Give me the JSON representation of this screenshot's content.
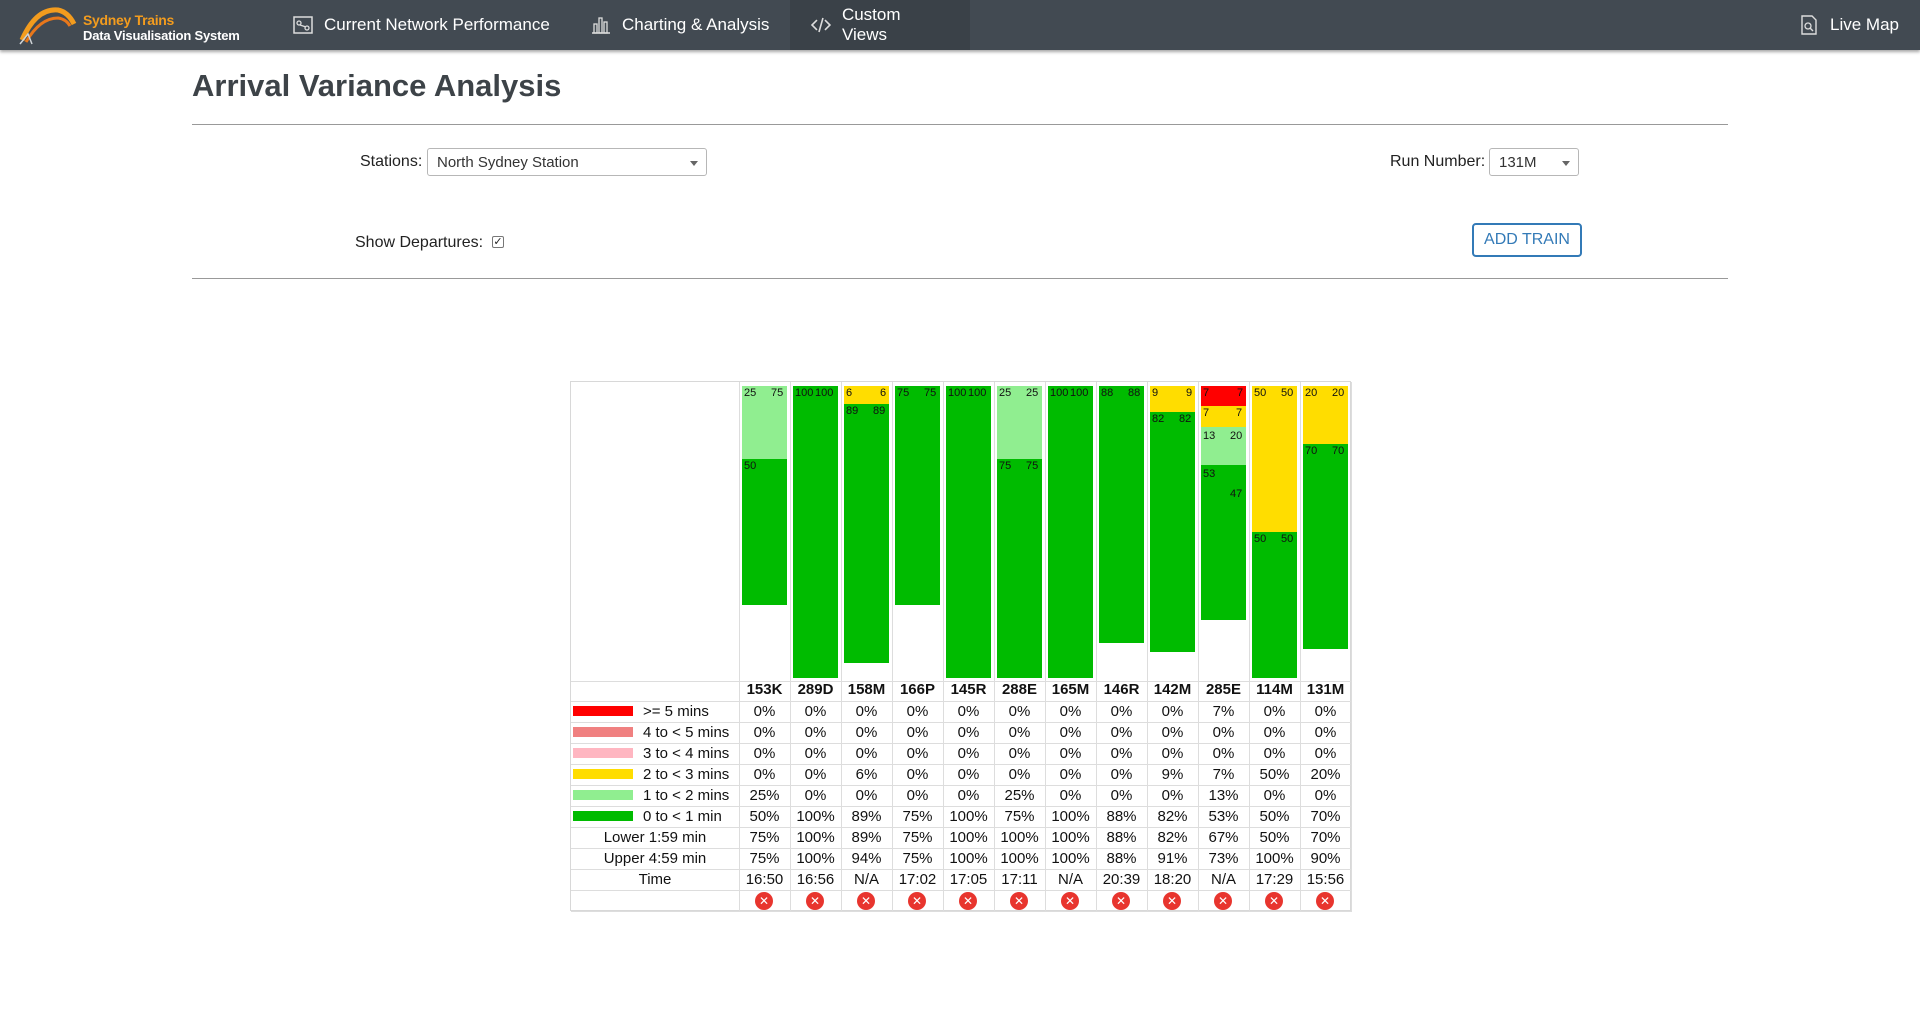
{
  "nav": {
    "brand_line1": "Sydney Trains",
    "brand_line2": "Data Visualisation System",
    "items": [
      {
        "label": "Current Network Performance",
        "icon": "network-icon"
      },
      {
        "label": "Charting & Analysis",
        "icon": "bar-chart-icon"
      },
      {
        "label": "Custom Views",
        "icon": "code-icon"
      }
    ],
    "right_item": {
      "label": "Live Map",
      "icon": "map-search-icon"
    },
    "active_index": 2
  },
  "page": {
    "title": "Arrival Variance Analysis"
  },
  "filters": {
    "stations_label": "Stations:",
    "stations_value": "North Sydney Station",
    "run_label": "Run Number:",
    "run_value": "131M",
    "show_departures_label": "Show Departures:",
    "show_departures_checked": true,
    "add_train_label": "ADD TRAIN"
  },
  "colors": {
    "ge5": "#ff0000",
    "4to5": "#f08080",
    "3to4": "#ffb6c1",
    "2to3": "#ffdd00",
    "1to2": "#90ee90",
    "0to1": "#00bb00"
  },
  "chart_data": {
    "type": "bar",
    "categories": [
      "153K",
      "289D",
      "158M",
      "166P",
      "145R",
      "288E",
      "165M",
      "146R",
      "142M",
      "285E",
      "114M",
      "131M"
    ],
    "series": [
      {
        "name": ">= 5 mins",
        "values": [
          0,
          0,
          0,
          0,
          0,
          0,
          0,
          0,
          0,
          7,
          0,
          0
        ]
      },
      {
        "name": "4 to < 5 mins",
        "values": [
          0,
          0,
          0,
          0,
          0,
          0,
          0,
          0,
          0,
          0,
          0,
          0
        ]
      },
      {
        "name": "3 to < 4 mins",
        "values": [
          0,
          0,
          0,
          0,
          0,
          0,
          0,
          0,
          0,
          0,
          0,
          0
        ]
      },
      {
        "name": "2 to < 3 mins",
        "values": [
          0,
          0,
          6,
          0,
          0,
          0,
          0,
          0,
          9,
          7,
          50,
          20
        ]
      },
      {
        "name": "1 to < 2 mins",
        "values": [
          25,
          0,
          0,
          0,
          0,
          25,
          0,
          0,
          0,
          13,
          0,
          0
        ]
      },
      {
        "name": "0 to < 1 min",
        "values": [
          50,
          100,
          89,
          75,
          100,
          75,
          100,
          88,
          82,
          53,
          50,
          70
        ]
      }
    ],
    "lower_159": [
      "75%",
      "100%",
      "89%",
      "75%",
      "100%",
      "100%",
      "100%",
      "88%",
      "82%",
      "67%",
      "50%",
      "70%"
    ],
    "upper_459": [
      "75%",
      "100%",
      "94%",
      "75%",
      "100%",
      "100%",
      "100%",
      "88%",
      "91%",
      "73%",
      "100%",
      "90%"
    ],
    "time": [
      "16:50",
      "16:56",
      "N/A",
      "17:02",
      "17:05",
      "17:11",
      "N/A",
      "20:39",
      "18:20",
      "N/A",
      "17:29",
      "15:56"
    ],
    "row_labels": {
      "lower": "Lower 1:59 min",
      "upper": "Upper 4:59 min",
      "time": "Time"
    },
    "bar_labels": [
      {
        "left": "25",
        "right": "75",
        "mid_left": "50"
      },
      {
        "left": "100",
        "right": "100"
      },
      {
        "left": "6",
        "right": "6",
        "sub_left": "89",
        "sub_right": "89"
      },
      {
        "left": "75",
        "right": "75"
      },
      {
        "left": "100",
        "right": "100"
      },
      {
        "left": "25",
        "right": "25",
        "sub_left": "75",
        "sub_right": "75"
      },
      {
        "left": "100",
        "right": "100"
      },
      {
        "left": "88",
        "right": "88"
      },
      {
        "left": "9",
        "right": "9",
        "sub_left": "82",
        "sub_right": "82"
      },
      {
        "left": "7",
        "right": "7",
        "row2_left": "7",
        "row2_right": "7",
        "row3_left": "13",
        "row3_right": "20",
        "row4_left": "53",
        "row4_right": "47"
      },
      {
        "left": "50",
        "right": "50",
        "sub_left": "50",
        "sub_right": "50"
      },
      {
        "left": "20",
        "right": "20",
        "sub_left": "70",
        "sub_right": "70"
      }
    ]
  }
}
